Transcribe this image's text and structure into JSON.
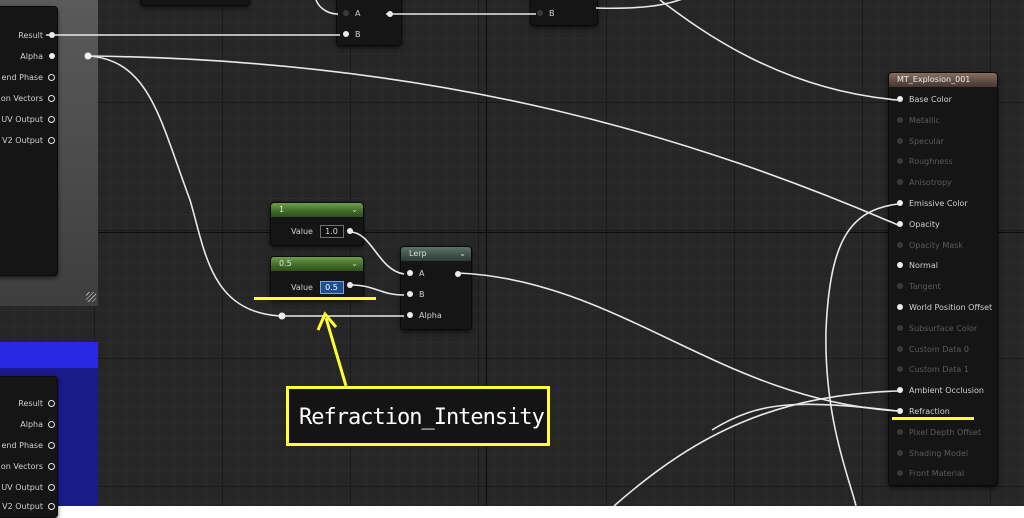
{
  "left_node_top": {
    "outputs": [
      "Result",
      "Alpha",
      "end Phase",
      "on Vectors",
      "UV Output",
      "V2 Output"
    ]
  },
  "left_node_bottom": {
    "outputs": [
      "Result",
      "Alpha",
      "end Phase",
      "on Vectors",
      "UV Output",
      "V2 Output"
    ]
  },
  "top_nodes": {
    "node_a": {
      "pins": [
        "A",
        "B"
      ]
    },
    "node_b": {
      "pins": [
        "B"
      ]
    }
  },
  "const_one": {
    "header": "1",
    "label": "Value",
    "value": "1.0"
  },
  "const_half": {
    "header": "0.5",
    "label": "Value",
    "value": "0.5"
  },
  "lerp": {
    "title": "Lerp",
    "pins": [
      "A",
      "B",
      "Alpha"
    ]
  },
  "material": {
    "title": "MT_Explosion_001",
    "pins": [
      {
        "label": "Base Color",
        "active": true
      },
      {
        "label": "Metallic",
        "active": false
      },
      {
        "label": "Specular",
        "active": false
      },
      {
        "label": "Roughness",
        "active": false
      },
      {
        "label": "Anisotropy",
        "active": false
      },
      {
        "label": "Emissive Color",
        "active": true
      },
      {
        "label": "Opacity",
        "active": true
      },
      {
        "label": "Opacity Mask",
        "active": false
      },
      {
        "label": "Normal",
        "active": true
      },
      {
        "label": "Tangent",
        "active": false
      },
      {
        "label": "World Position Offset",
        "active": true
      },
      {
        "label": "Subsurface Color",
        "active": false
      },
      {
        "label": "Custom Data 0",
        "active": false
      },
      {
        "label": "Custom Data 1",
        "active": false
      },
      {
        "label": "Ambient Occlusion",
        "active": true
      },
      {
        "label": "Refraction",
        "active": true
      },
      {
        "label": "Pixel Depth Offset",
        "active": false
      },
      {
        "label": "Shading Model",
        "active": false
      },
      {
        "label": "Front Material",
        "active": false
      }
    ]
  },
  "annotation": {
    "text": "Refraction_Intensity",
    "color": "#ffff33"
  }
}
